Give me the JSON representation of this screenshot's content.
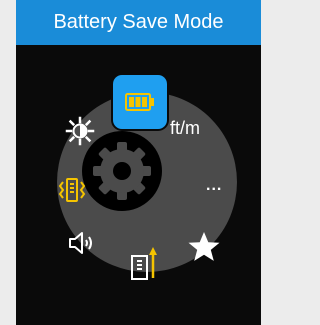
{
  "header": {
    "title": "Battery Save Mode"
  },
  "menu": {
    "selected": "battery-save",
    "unit_label": "ft/m",
    "more_label": "...",
    "items": [
      {
        "icon": "brightness-icon"
      },
      {
        "icon": "battery-icon"
      },
      {
        "icon": "vibration-icon"
      },
      {
        "icon": "volume-icon"
      },
      {
        "icon": "reference-point-icon"
      },
      {
        "icon": "star-icon"
      },
      {
        "icon": "settings-gear-icon"
      }
    ]
  },
  "colors": {
    "title_bar": "#1a8cd8",
    "selected_item": "#1f9ff0",
    "accent_yellow": "#f5c400",
    "wheel": "#4b4b4b"
  }
}
